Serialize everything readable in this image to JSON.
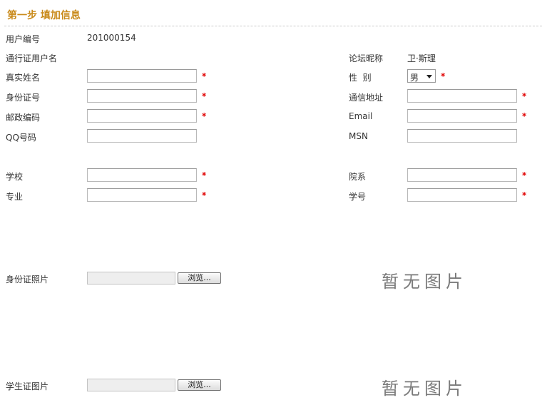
{
  "step_title": "第一步  填加信息",
  "fields": {
    "user_id": {
      "label": "用户编号",
      "value": "201000154"
    },
    "passport_user": {
      "label": "通行证用户名",
      "value": ""
    },
    "forum_nickname": {
      "label": "论坛昵称",
      "value": "卫·斯理"
    },
    "real_name": {
      "label": "真实姓名",
      "value": ""
    },
    "gender": {
      "label": "性  别",
      "value": "男"
    },
    "id_number": {
      "label": "身份证号",
      "value": ""
    },
    "address": {
      "label": "通信地址",
      "value": ""
    },
    "postal_code": {
      "label": "邮政编码",
      "value": ""
    },
    "email": {
      "label": "Email",
      "value": ""
    },
    "qq": {
      "label": "QQ号码",
      "value": ""
    },
    "msn": {
      "label": "MSN",
      "value": ""
    },
    "school": {
      "label": "学校",
      "value": ""
    },
    "department": {
      "label": "院系",
      "value": ""
    },
    "major": {
      "label": "专业",
      "value": ""
    },
    "student_no": {
      "label": "学号",
      "value": ""
    }
  },
  "required_mark": "*",
  "uploads": {
    "id_photo": {
      "label": "身份证照片",
      "button": "浏览...",
      "placeholder_text": "暂无图片"
    },
    "student_card_photo": {
      "label": "学生证图片",
      "button": "浏览...",
      "placeholder_text": "暂无图片"
    }
  }
}
